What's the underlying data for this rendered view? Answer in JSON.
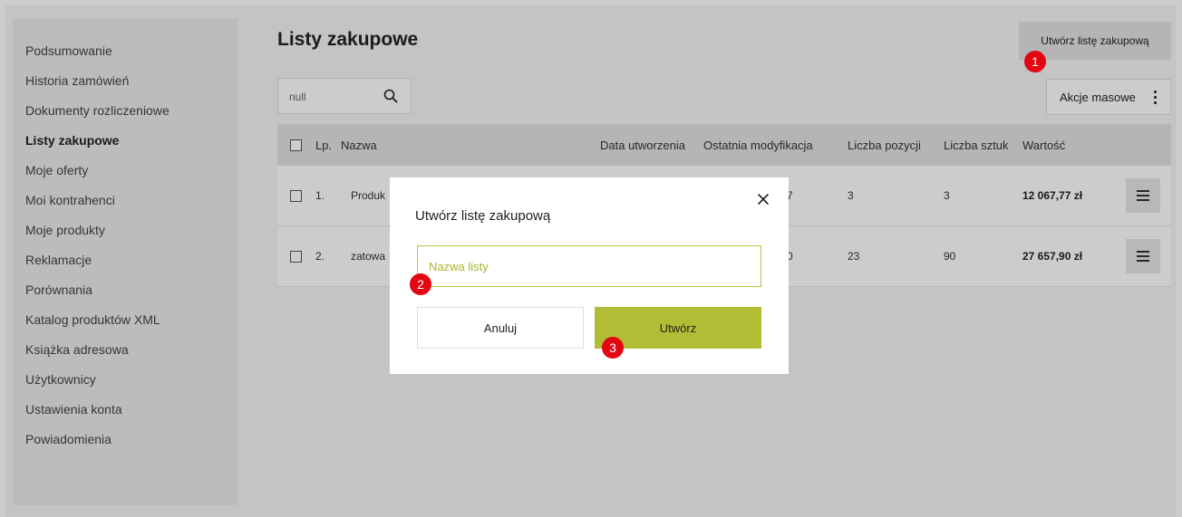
{
  "sidebar": {
    "items": [
      {
        "label": "Podsumowanie"
      },
      {
        "label": "Historia zamówień"
      },
      {
        "label": "Dokumenty rozliczeniowe"
      },
      {
        "label": "Listy zakupowe"
      },
      {
        "label": "Moje oferty"
      },
      {
        "label": "Moi kontrahenci"
      },
      {
        "label": "Moje produkty"
      },
      {
        "label": "Reklamacje"
      },
      {
        "label": "Porównania"
      },
      {
        "label": "Katalog produktów XML"
      },
      {
        "label": "Książka adresowa"
      },
      {
        "label": "Użytkownicy"
      },
      {
        "label": "Ustawienia konta"
      },
      {
        "label": "Powiadomienia"
      }
    ],
    "active": "Listy zakupowe"
  },
  "header": {
    "title": "Listy zakupowe",
    "create_label": "Utwórz listę zakupową"
  },
  "search": {
    "value": "null",
    "icon": "search-icon"
  },
  "bulk": {
    "label": "Akcje masowe",
    "icon": "kebab-icon"
  },
  "table": {
    "headers": {
      "lp": "Lp.",
      "name": "Nazwa",
      "created": "Data utworzenia",
      "modified": "Ostatnia modyfikacja",
      "positions": "Liczba pozycji",
      "pieces": "Liczba sztuk",
      "value": "Wartość"
    },
    "rows": [
      {
        "lp": "1.",
        "name": "Produk",
        "modified": "7",
        "positions": "3",
        "pieces": "3",
        "value": "12 067,77 zł"
      },
      {
        "lp": "2.",
        "name": "zatowa",
        "modified": "0",
        "positions": "23",
        "pieces": "90",
        "value": "27 657,90 zł"
      }
    ]
  },
  "modal": {
    "title": "Utwórz listę zakupową",
    "input_placeholder": "Nazwa listy",
    "cancel_label": "Anuluj",
    "submit_label": "Utwórz"
  },
  "badges": [
    "1",
    "2",
    "3"
  ],
  "colors": {
    "accent": "#b2bd36",
    "badge": "#e30613",
    "overlay": "rgba(0,0,0,0.2)"
  }
}
